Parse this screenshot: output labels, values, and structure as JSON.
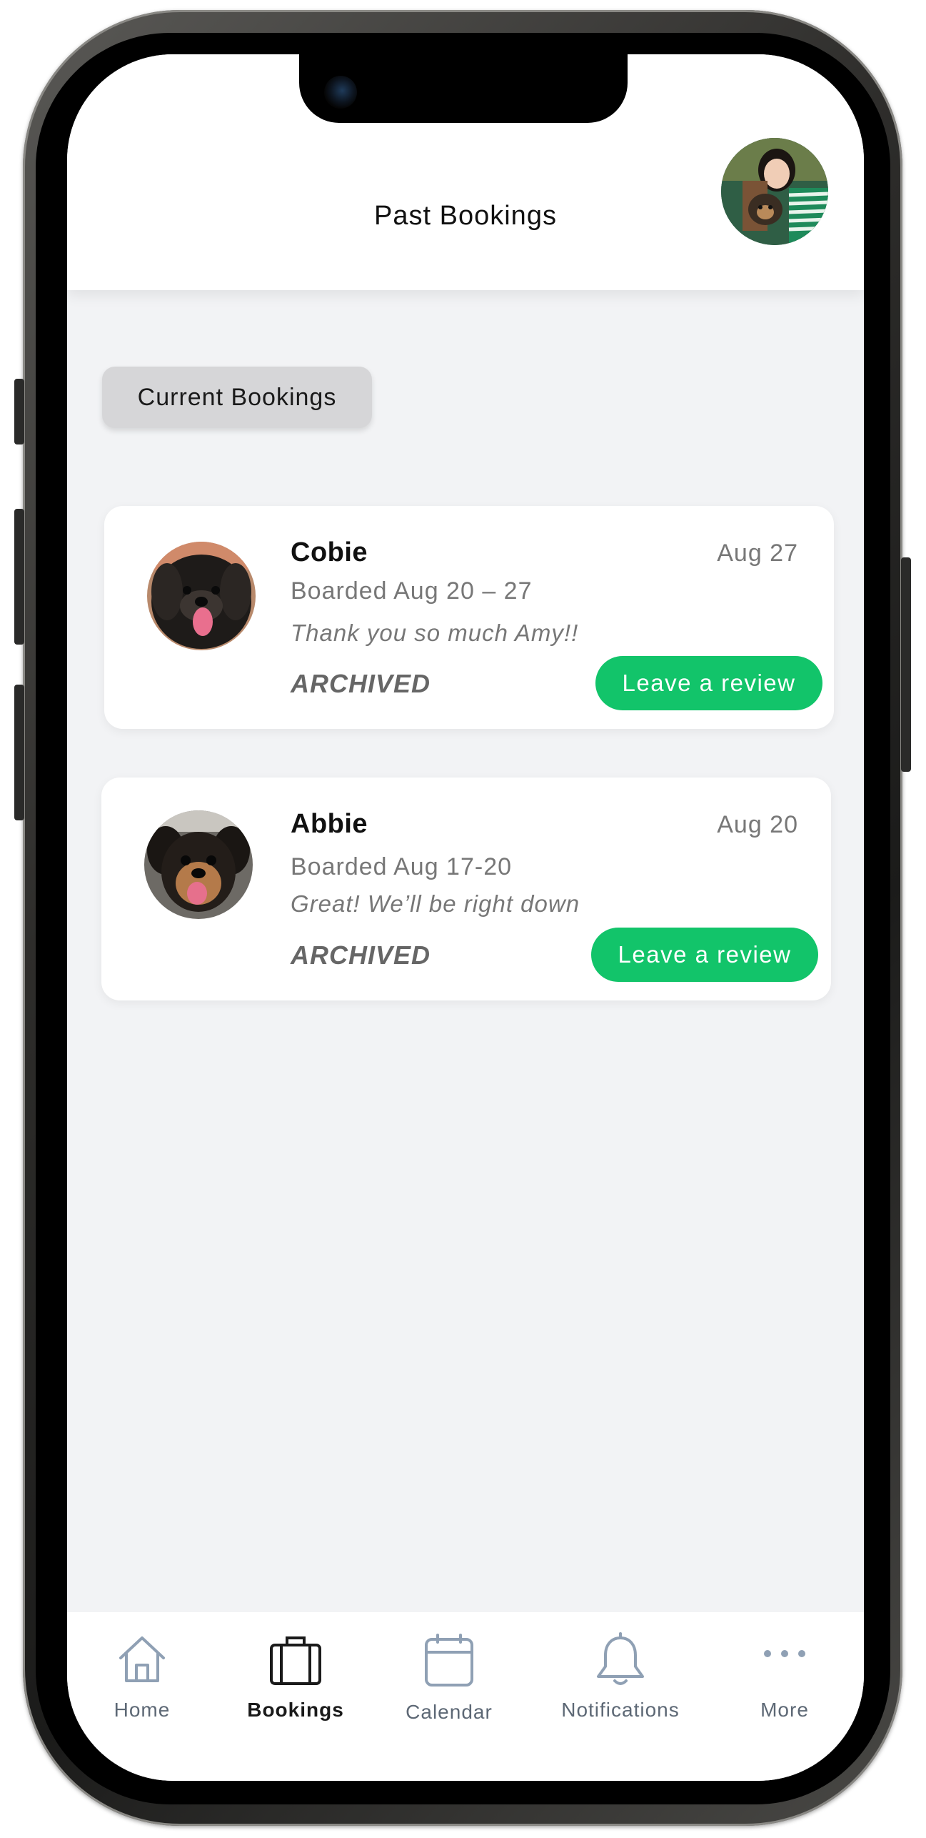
{
  "header": {
    "title": "Past Bookings"
  },
  "toggle": {
    "label": "Current Bookings"
  },
  "bookings": [
    {
      "name": "Cobie",
      "date": "Aug 27",
      "boarded": "Boarded Aug 20 – 27",
      "message": "Thank you so much Amy!!",
      "status": "ARCHIVED",
      "action": "Leave a review"
    },
    {
      "name": "Abbie",
      "date": "Aug 20",
      "boarded": "Boarded Aug 17-20",
      "message": "Great! We’ll be right down",
      "status": "ARCHIVED",
      "action": "Leave a review"
    }
  ],
  "tabs": [
    {
      "label": "Home",
      "icon": "home-icon",
      "active": false
    },
    {
      "label": "Bookings",
      "icon": "suitcase-icon",
      "active": true
    },
    {
      "label": "Calendar",
      "icon": "calendar-icon",
      "active": false
    },
    {
      "label": "Notifications",
      "icon": "bell-icon",
      "active": false
    },
    {
      "label": "More",
      "icon": "more-dots-icon",
      "active": false
    }
  ],
  "colors": {
    "accent": "#12c46a",
    "background": "#f2f3f5",
    "tab_inactive": "#8fa0b4",
    "tab_active": "#1a1a1a"
  }
}
